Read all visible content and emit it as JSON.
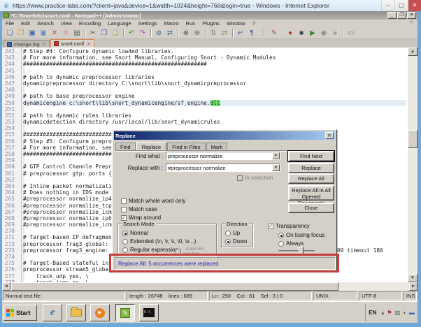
{
  "browser": {
    "title": "https://www.practice-labs.com/?client=java&device=1&width=1024&height=768&login=true - Windows  - Internet Explorer",
    "minimize": "–",
    "maximize": "▢",
    "close": "✕"
  },
  "notepad": {
    "title": "*C:\\Snort\\etc\\snort.conf - Notepad++ [Administrator]",
    "window_buttons": {
      "minimize": "_",
      "restore": "❐",
      "close": "✕"
    },
    "menus": [
      "File",
      "Edit",
      "Search",
      "View",
      "Encoding",
      "Language",
      "Settings",
      "Macro",
      "Run",
      "Plugins",
      "Window",
      "?"
    ],
    "toolbar_icons": [
      {
        "name": "new-file-icon",
        "g": "❏",
        "c": "#5a78b8"
      },
      {
        "name": "open-file-icon",
        "g": "❒",
        "c": "#d8a032"
      },
      {
        "name": "save-icon",
        "g": "▣",
        "c": "#3a66aa"
      },
      {
        "name": "save-all-icon",
        "g": "▣",
        "c": "#6a86c0"
      },
      {
        "name": "close-file-icon",
        "g": "✕",
        "c": "#b05050"
      },
      {
        "name": "close-all-icon",
        "g": "✕",
        "c": "#d08080"
      },
      {
        "name": "print-icon",
        "g": "▤",
        "c": "#666666"
      },
      {
        "name": "sep",
        "g": "|",
        "c": ""
      },
      {
        "name": "cut-icon",
        "g": "✂",
        "c": "#555555"
      },
      {
        "name": "copy-icon",
        "g": "❐",
        "c": "#5a78b8"
      },
      {
        "name": "paste-icon",
        "g": "❑",
        "c": "#b8923a"
      },
      {
        "name": "sep",
        "g": "|",
        "c": ""
      },
      {
        "name": "undo-icon",
        "g": "↶",
        "c": "#3aa03a"
      },
      {
        "name": "redo-icon",
        "g": "↷",
        "c": "#8a5ab8"
      },
      {
        "name": "sep",
        "g": "|",
        "c": ""
      },
      {
        "name": "find-icon",
        "g": "⊚",
        "c": "#3a66aa"
      },
      {
        "name": "replace-icon",
        "g": "⇄",
        "c": "#3a66aa"
      },
      {
        "name": "sep",
        "g": "|",
        "c": ""
      },
      {
        "name": "zoom-in-icon",
        "g": "⊕",
        "c": "#555555"
      },
      {
        "name": "zoom-out-icon",
        "g": "⊖",
        "c": "#555555"
      },
      {
        "name": "sep",
        "g": "|",
        "c": ""
      },
      {
        "name": "sync-vertical-icon",
        "g": "⇅",
        "c": "#888888"
      },
      {
        "name": "sync-horizontal-icon",
        "g": "⇄",
        "c": "#888888"
      },
      {
        "name": "sep",
        "g": "|",
        "c": ""
      },
      {
        "name": "word-wrap-icon",
        "g": "↵",
        "c": "#3a66aa"
      },
      {
        "name": "show-all-chars-icon",
        "g": "¶",
        "c": "#3a66aa"
      },
      {
        "name": "indent-guide-icon",
        "g": "⋮",
        "c": "#888888"
      },
      {
        "name": "user-define-dialog-icon",
        "g": "✎",
        "c": "#a05050"
      },
      {
        "name": "sep",
        "g": "|",
        "c": ""
      },
      {
        "name": "macro-record-icon",
        "g": "●",
        "c": "#c03030"
      },
      {
        "name": "macro-stop-icon",
        "g": "■",
        "c": "#444444"
      },
      {
        "name": "macro-play-icon",
        "g": "▶",
        "c": "#3a8a3a"
      },
      {
        "name": "macro-save-icon",
        "g": "◉",
        "c": "#888888"
      },
      {
        "name": "macro-run-multi-icon",
        "g": "»",
        "c": "#555555"
      },
      {
        "name": "sep",
        "g": "|",
        "c": ""
      },
      {
        "name": "doc-monitor-icon",
        "g": "▭",
        "c": "#888888"
      }
    ],
    "tabs": [
      {
        "label": "change.log",
        "active": false,
        "unsaved": false,
        "close": "✕"
      },
      {
        "label": "snort.conf",
        "active": true,
        "unsaved": true,
        "close": "✕"
      }
    ],
    "editor": {
      "lines": [
        {
          "n": "242",
          "t": "# Step #4: Configure dynamic loaded libraries."
        },
        {
          "n": "243",
          "t": "# For more information, see Snort Manual, Configuring Snort - Dynamic Modules"
        },
        {
          "n": "244",
          "t": "########################################################"
        },
        {
          "n": "245",
          "t": ""
        },
        {
          "n": "246",
          "t": "# path to dynamic preprocessor libraries"
        },
        {
          "n": "247",
          "t": "dynamicpreprocessor directory C:\\snort\\lib\\snort_dynamicpreprocessor"
        },
        {
          "n": "248",
          "t": ""
        },
        {
          "n": "249",
          "t": "# path to base preprocessor engine"
        },
        {
          "n": "250",
          "t": "dynamicengine c:\\snort\\lib\\snort_dynamicengine/sf_engine.",
          "hl": "dll",
          "cur": true
        },
        {
          "n": "251",
          "t": ""
        },
        {
          "n": "252",
          "t": "# path to dynamic rules libraries"
        },
        {
          "n": "253",
          "t": "dynamicdetection directory /usr/local/lib/snort_dynamicrules"
        },
        {
          "n": "254",
          "t": ""
        },
        {
          "n": "255",
          "t": "##############################"
        },
        {
          "n": "256",
          "t": "# Step #5: Configure preproce"
        },
        {
          "n": "257",
          "t": "# For more information, see "
        },
        {
          "n": "258",
          "t": "##############################"
        },
        {
          "n": "259",
          "t": ""
        },
        {
          "n": "260",
          "t": "# GTP Control Channle Preproc"
        },
        {
          "n": "261",
          "t": "# preprocessor gtp: ports {"
        },
        {
          "n": "262",
          "t": ""
        },
        {
          "n": "263",
          "t": "# Inline packet normalizatio"
        },
        {
          "n": "264",
          "t": "# Does nothing in IDS mode"
        },
        {
          "n": "265",
          "t": "#preprocessor normalize_ip4"
        },
        {
          "n": "266",
          "t": "#preprocessor normalize_tcp:"
        },
        {
          "n": "267",
          "t": "#preprocessor normalize_icmp"
        },
        {
          "n": "268",
          "t": "#preprocessor normalize_ip6"
        },
        {
          "n": "269",
          "t": "#preprocessor normalize_icmp"
        },
        {
          "n": "270",
          "t": ""
        },
        {
          "n": "271",
          "t": "# Target-based IP defragment"
        },
        {
          "n": "272",
          "t": "preprocessor frag3_global: m"
        },
        {
          "n": "273",
          "t": "preprocessor frag3_engine: p"
        },
        {
          "n": "274",
          "t": ""
        },
        {
          "n": "275",
          "t": "# Target-Based stateful ins"
        },
        {
          "n": "276",
          "t": "preprocessor stream5_global: track_tcp yes, \\"
        },
        {
          "n": "277",
          "t": "    track_udp yes, \\"
        },
        {
          "n": "278",
          "t": "    track_icmp no, \\"
        }
      ],
      "line273_tail": "00 timeout 180"
    },
    "status_bar": {
      "doc_type": "Normal text file",
      "length_info": "length : 26748    lines : 689",
      "cursor_info": "Ln : 250    Col : 61    Sel : 3 | 0",
      "eol": "UNIX",
      "encoding": "UTF-8",
      "ins_mode": "INS"
    }
  },
  "replace_dialog": {
    "title": "Replace",
    "close": "✕",
    "tabs": [
      "Find",
      "Replace",
      "Find in Files",
      "Mark"
    ],
    "find_what_label": "Find what :",
    "find_what_value": "preprocessor normalize",
    "replace_with_label": "Replace with :",
    "replace_with_value": "#preprocessor normalize",
    "buttons": {
      "find_next": "Find Next",
      "replace": "Replace",
      "replace_all": "Replace All",
      "replace_all_docs": "Replace All in All Opened Documents",
      "close": "Close"
    },
    "in_selection_label": "In selection",
    "match_whole_word_label": "Match whole word only",
    "match_case_label": "Match case",
    "wrap_around_label": "Wrap around",
    "search_mode_legend": "Search Mode",
    "search_normal_label": "Normal",
    "search_extended_label": "Extended (\\n, \\r, \\t, \\0, \\x...)",
    "search_regex_label": "Regular expression",
    "matches_newline_label": ". matches newline",
    "direction_legend": "Direction",
    "direction_up_label": "Up",
    "direction_down_label": "Down",
    "transparency_label": "Transparency",
    "transparency_on_losing_label": "On losing focus",
    "transparency_always_label": "Always",
    "status_message": "Replace All: 5 occurrences were replaced.",
    "status_color": "#2020c8",
    "annotation_color": "#c43c3c"
  },
  "taskbar": {
    "start_label": "Start",
    "cmd_label": "C:\\",
    "media_glyph": "▶",
    "npp_glyph": "✎",
    "tray_lang": "EN",
    "tray_icons": [
      {
        "name": "show-hidden-icons-icon",
        "g": "▴",
        "c": "#555555"
      },
      {
        "name": "action-center-icon",
        "g": "⚑",
        "c": "#b03030"
      },
      {
        "name": "network-icon",
        "g": "▥",
        "c": "#555555"
      },
      {
        "name": "volume-icon",
        "g": "◗",
        "c": "#555555"
      },
      {
        "name": "remote-display-icon",
        "g": "▬",
        "c": "#3a66aa"
      }
    ]
  }
}
